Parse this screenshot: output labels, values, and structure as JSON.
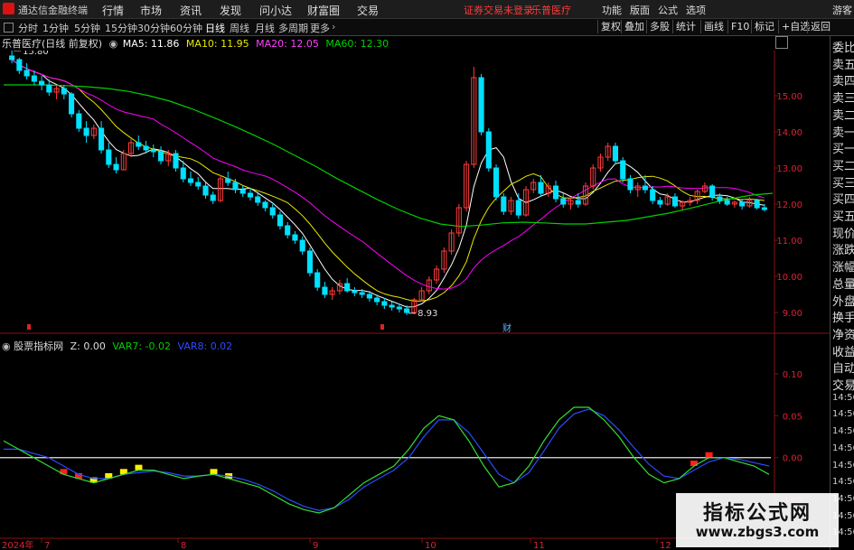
{
  "app": {
    "name": "通达信金融终端"
  },
  "menu": [
    "行情",
    "市场",
    "资讯",
    "发现",
    "问小达",
    "财富圈",
    "交易"
  ],
  "warning": "证券交易未登录",
  "stock_tag": "乐普医疗",
  "top_right": [
    "功能",
    "版面",
    "公式",
    "选项",
    "游客"
  ],
  "periods": [
    "分时",
    "1分钟",
    "5分钟",
    "15分钟",
    "30分钟",
    "60分钟",
    "日线",
    "周线",
    "月线",
    "多周期",
    "更多"
  ],
  "active_period": "日线",
  "tools": [
    "复权",
    "叠加",
    "多股",
    "统计",
    "画线",
    "F10",
    "标记",
    "+自选",
    "返回"
  ],
  "header": {
    "title": "乐普医疗(日线 前复权)",
    "ma5": "MA5: 11.86",
    "ma10": "MA10: 11.95",
    "ma20": "MA20: 12.05",
    "ma60": "MA60: 12.30"
  },
  "price_axis": [
    "15.00",
    "14.00",
    "13.00",
    "12.00",
    "11.00",
    "10.00",
    "9.00"
  ],
  "annotations": {
    "high": "15.80",
    "low": "8.93",
    "fin": "财"
  },
  "indicator": {
    "title": "股票指标网",
    "z": "Z: 0.00",
    "var7": "VAR7: -0.02",
    "var8": "VAR8: 0.02"
  },
  "ind_axis": [
    "0.10",
    "0.05",
    "0.00",
    "-0.05"
  ],
  "x_axis": [
    "2024年",
    "7",
    "8",
    "9",
    "10",
    "11",
    "12"
  ],
  "right_panel": [
    "委比",
    "卖五",
    "卖四",
    "卖三",
    "卖二",
    "卖一",
    "买一",
    "买二",
    "买三",
    "买四",
    "买五",
    "现价",
    "涨跌",
    "涨幅",
    "总量",
    "外盘",
    "换手",
    "净资",
    "收益",
    "自动",
    "交易",
    "14:56",
    "14:56",
    "14:56",
    "14:56",
    "14:56",
    "14:56",
    "14:56",
    "14:56",
    "14:56"
  ],
  "watermark": {
    "title": "指标公式网",
    "url": "www.zbgs3.com"
  },
  "colors": {
    "up": "#ff3c3c",
    "down": "#00e0ff",
    "ma5": "#ffffff",
    "ma10": "#e8e800",
    "ma20": "#ff00ff",
    "ma60": "#00d000"
  },
  "chart_data": [
    {
      "type": "candlestick",
      "title": "乐普医疗(日线 前复权)",
      "ylim": [
        8.6,
        16.2
      ],
      "ohlc": [
        [
          16.1,
          16.3,
          15.9,
          16.0
        ],
        [
          16.0,
          16.05,
          15.6,
          15.7
        ],
        [
          15.7,
          15.9,
          15.45,
          15.55
        ],
        [
          15.55,
          15.7,
          15.3,
          15.4
        ],
        [
          15.4,
          15.55,
          15.15,
          15.3
        ],
        [
          15.3,
          15.45,
          15.0,
          15.1
        ],
        [
          15.1,
          15.3,
          14.9,
          15.2
        ],
        [
          15.2,
          15.3,
          14.9,
          15.05
        ],
        [
          15.05,
          15.1,
          14.4,
          14.5
        ],
        [
          14.5,
          14.6,
          14.0,
          14.1
        ],
        [
          14.1,
          14.3,
          13.7,
          13.9
        ],
        [
          13.9,
          14.2,
          13.8,
          14.1
        ],
        [
          14.1,
          14.3,
          13.4,
          13.5
        ],
        [
          13.5,
          13.7,
          13.0,
          13.1
        ],
        [
          13.1,
          13.3,
          12.85,
          12.95
        ],
        [
          12.95,
          13.5,
          12.95,
          13.4
        ],
        [
          13.4,
          13.8,
          13.3,
          13.7
        ],
        [
          13.7,
          13.9,
          13.5,
          13.6
        ],
        [
          13.6,
          13.75,
          13.4,
          13.5
        ],
        [
          13.5,
          13.65,
          13.3,
          13.45
        ],
        [
          13.45,
          13.6,
          13.1,
          13.2
        ],
        [
          13.2,
          13.5,
          13.05,
          13.4
        ],
        [
          13.4,
          13.5,
          12.9,
          13.0
        ],
        [
          13.0,
          13.2,
          12.6,
          12.7
        ],
        [
          12.7,
          12.9,
          12.5,
          12.6
        ],
        [
          12.6,
          12.75,
          12.4,
          12.5
        ],
        [
          12.5,
          12.6,
          12.15,
          12.25
        ],
        [
          12.25,
          12.35,
          12.0,
          12.1
        ],
        [
          12.1,
          12.8,
          12.05,
          12.7
        ],
        [
          12.7,
          12.9,
          12.5,
          12.6
        ],
        [
          12.6,
          12.7,
          12.3,
          12.4
        ],
        [
          12.4,
          12.5,
          12.2,
          12.3
        ],
        [
          12.3,
          12.45,
          12.1,
          12.2
        ],
        [
          12.2,
          12.3,
          11.95,
          12.05
        ],
        [
          12.05,
          12.1,
          11.8,
          11.9
        ],
        [
          11.9,
          12.0,
          11.6,
          11.7
        ],
        [
          11.7,
          11.8,
          11.3,
          11.4
        ],
        [
          11.4,
          11.5,
          11.05,
          11.15
        ],
        [
          11.15,
          11.25,
          10.9,
          11.0
        ],
        [
          11.0,
          11.1,
          10.6,
          10.7
        ],
        [
          10.7,
          10.8,
          10.0,
          10.1
        ],
        [
          10.1,
          10.2,
          9.6,
          9.7
        ],
        [
          9.7,
          9.85,
          9.4,
          9.5
        ],
        [
          9.5,
          9.7,
          9.35,
          9.6
        ],
        [
          9.6,
          9.9,
          9.5,
          9.8
        ],
        [
          9.8,
          9.95,
          9.55,
          9.6
        ],
        [
          9.6,
          9.7,
          9.45,
          9.55
        ],
        [
          9.55,
          9.65,
          9.4,
          9.5
        ],
        [
          9.5,
          9.6,
          9.3,
          9.4
        ],
        [
          9.4,
          9.5,
          9.2,
          9.3
        ],
        [
          9.3,
          9.4,
          9.1,
          9.2
        ],
        [
          9.2,
          9.3,
          9.05,
          9.15
        ],
        [
          9.15,
          9.25,
          9.0,
          9.1
        ],
        [
          9.1,
          9.2,
          8.93,
          9.0
        ],
        [
          9.0,
          9.4,
          8.95,
          9.35
        ],
        [
          9.35,
          9.7,
          9.3,
          9.6
        ],
        [
          9.6,
          10.0,
          9.5,
          9.9
        ],
        [
          9.9,
          10.3,
          9.8,
          10.2
        ],
        [
          10.2,
          10.8,
          10.1,
          10.7
        ],
        [
          10.7,
          11.3,
          10.6,
          11.2
        ],
        [
          11.2,
          12.0,
          11.1,
          11.9
        ],
        [
          11.9,
          13.2,
          11.8,
          13.1
        ],
        [
          13.1,
          15.8,
          13.0,
          15.5
        ],
        [
          15.5,
          15.6,
          13.9,
          14.0
        ],
        [
          14.0,
          14.1,
          12.9,
          13.0
        ],
        [
          13.0,
          13.1,
          12.1,
          12.2
        ],
        [
          12.2,
          12.3,
          11.7,
          11.8
        ],
        [
          11.8,
          12.2,
          11.7,
          12.1
        ],
        [
          12.1,
          12.3,
          11.6,
          11.7
        ],
        [
          11.7,
          12.5,
          11.65,
          12.4
        ],
        [
          12.4,
          12.7,
          12.3,
          12.6
        ],
        [
          12.6,
          12.8,
          12.2,
          12.3
        ],
        [
          12.3,
          12.6,
          12.2,
          12.5
        ],
        [
          12.5,
          12.65,
          12.05,
          12.15
        ],
        [
          12.15,
          12.3,
          11.9,
          12.0
        ],
        [
          12.0,
          12.2,
          11.85,
          12.1
        ],
        [
          12.1,
          12.3,
          11.9,
          12.0
        ],
        [
          12.0,
          12.6,
          11.95,
          12.5
        ],
        [
          12.5,
          13.1,
          12.4,
          13.0
        ],
        [
          13.0,
          13.4,
          12.9,
          13.3
        ],
        [
          13.3,
          13.7,
          13.2,
          13.6
        ],
        [
          13.6,
          13.7,
          13.1,
          13.2
        ],
        [
          13.2,
          13.3,
          12.6,
          12.7
        ],
        [
          12.7,
          12.8,
          12.3,
          12.4
        ],
        [
          12.4,
          12.6,
          12.2,
          12.5
        ],
        [
          12.5,
          12.8,
          12.3,
          12.4
        ],
        [
          12.4,
          12.5,
          12.0,
          12.1
        ],
        [
          12.1,
          12.2,
          11.9,
          12.0
        ],
        [
          12.0,
          12.3,
          11.95,
          12.2
        ],
        [
          12.2,
          12.3,
          11.9,
          11.95
        ],
        [
          11.95,
          12.1,
          11.85,
          12.05
        ],
        [
          12.05,
          12.2,
          11.95,
          12.1
        ],
        [
          12.1,
          12.4,
          12.0,
          12.35
        ],
        [
          12.35,
          12.6,
          12.3,
          12.5
        ],
        [
          12.5,
          12.55,
          12.1,
          12.2
        ],
        [
          12.2,
          12.3,
          12.0,
          12.1
        ],
        [
          12.1,
          12.2,
          11.95,
          12.0
        ],
        [
          12.0,
          12.1,
          11.9,
          12.05
        ],
        [
          12.05,
          12.15,
          11.85,
          11.95
        ],
        [
          11.95,
          12.2,
          11.9,
          12.1
        ],
        [
          12.1,
          12.15,
          11.85,
          11.9
        ],
        [
          11.9,
          12.0,
          11.8,
          11.85
        ]
      ],
      "ma_series": [
        {
          "name": "MA60",
          "values": [
            15.3,
            15.3,
            15.3,
            15.28,
            15.25,
            15.2,
            15.12,
            15.0,
            14.85,
            14.65,
            14.42,
            14.18,
            13.92,
            13.65,
            13.35,
            13.05,
            12.72,
            12.42,
            12.12,
            11.85,
            11.62,
            11.45,
            11.38,
            11.42,
            11.48,
            11.5,
            11.48,
            11.45,
            11.45,
            11.5,
            11.55,
            11.65,
            11.75,
            11.88,
            12.02,
            12.15,
            12.25,
            12.3
          ]
        }
      ]
    },
    {
      "type": "line",
      "title": "股票指标网",
      "ylim": [
        -0.08,
        0.13
      ],
      "series": [
        {
          "name": "VAR7",
          "values": [
            0.02,
            0.01,
            0.0,
            -0.01,
            -0.02,
            -0.025,
            -0.03,
            -0.025,
            -0.02,
            -0.015,
            -0.015,
            -0.02,
            -0.025,
            -0.022,
            -0.02,
            -0.025,
            -0.03,
            -0.035,
            -0.045,
            -0.055,
            -0.062,
            -0.066,
            -0.06,
            -0.045,
            -0.03,
            -0.02,
            -0.01,
            0.01,
            0.035,
            0.05,
            0.045,
            0.02,
            -0.01,
            -0.035,
            -0.03,
            -0.01,
            0.02,
            0.045,
            0.06,
            0.06,
            0.045,
            0.025,
            0.0,
            -0.02,
            -0.03,
            -0.025,
            -0.01,
            0.0,
            0.0,
            -0.005,
            -0.01,
            -0.02
          ]
        },
        {
          "name": "VAR8",
          "values": [
            0.01,
            0.01,
            0.005,
            0.0,
            -0.01,
            -0.02,
            -0.025,
            -0.025,
            -0.02,
            -0.018,
            -0.016,
            -0.018,
            -0.022,
            -0.022,
            -0.02,
            -0.022,
            -0.026,
            -0.032,
            -0.04,
            -0.05,
            -0.058,
            -0.063,
            -0.06,
            -0.05,
            -0.035,
            -0.025,
            -0.015,
            0.0,
            0.025,
            0.045,
            0.045,
            0.03,
            0.005,
            -0.02,
            -0.03,
            -0.018,
            0.008,
            0.035,
            0.052,
            0.058,
            0.05,
            0.033,
            0.012,
            -0.008,
            -0.022,
            -0.025,
            -0.015,
            -0.005,
            0.0,
            -0.002,
            -0.006,
            -0.01
          ]
        }
      ]
    }
  ]
}
